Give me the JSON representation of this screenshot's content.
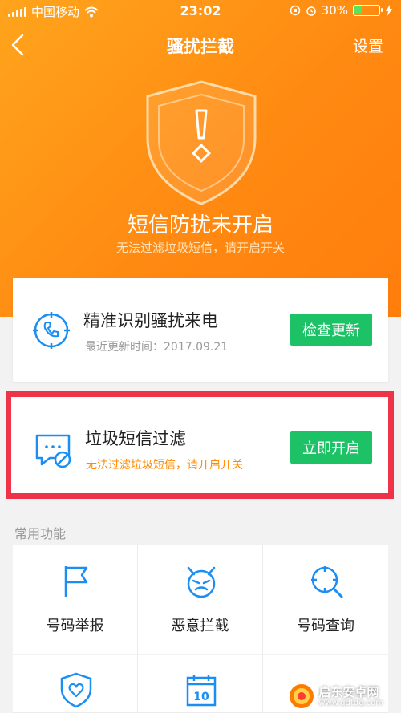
{
  "status_bar": {
    "carrier": "中国移动",
    "time": "23:02",
    "battery": "30%",
    "battery_level": 0.3
  },
  "nav": {
    "title": "骚扰拦截",
    "settings_label": "设置"
  },
  "hero": {
    "title": "短信防扰未开启",
    "subtitle": "无法过滤垃圾短信，请开启开关"
  },
  "card_call": {
    "title": "精准识别骚扰来电",
    "subtitle": "最近更新时间：2017.09.21",
    "button_label": "检查更新"
  },
  "card_sms": {
    "title": "垃圾短信过滤",
    "subtitle": "无法过滤垃圾短信，请开启开关",
    "button_label": "立即开启"
  },
  "section": {
    "label": "常用功能"
  },
  "features": [
    {
      "label": "号码举报",
      "icon": "flag-icon"
    },
    {
      "label": "恶意拦截",
      "icon": "devil-face-icon"
    },
    {
      "label": "号码查询",
      "icon": "crosshair-search-icon"
    },
    {
      "label": "",
      "icon": "heart-shield-icon"
    },
    {
      "label": "",
      "icon": "calendar-icon"
    },
    {
      "label": "",
      "icon": ""
    }
  ],
  "watermark": {
    "text": "启东安卓网",
    "url": "www.qdtdq.com"
  },
  "colors": {
    "hero_orange": "#ff8c12",
    "accent_blue": "#1a8ef2",
    "button_green": "#1dc266",
    "warning_orange": "#ff8a00",
    "highlight_red": "#ef3349"
  }
}
